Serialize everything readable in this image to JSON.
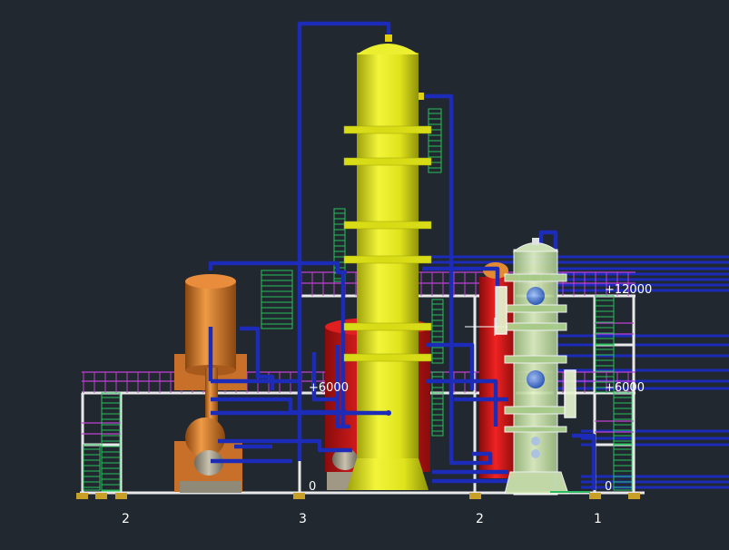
{
  "elevations": {
    "top": "+12000",
    "middle_left": "+6000",
    "middle_right": "+6000",
    "ground_left": "0",
    "ground_right": "0"
  },
  "grid_axes": [
    "2",
    "3",
    "2",
    "1"
  ],
  "colors": {
    "background": "#212830",
    "pipe": "#1c2bb8",
    "main_column": "#e6eb1e",
    "copper_vessel": "#d5782a",
    "red_vessel": "#d81818",
    "glass_column": "#c9e8a0",
    "platform": "#e8e8e8",
    "handrail": "#c040d0",
    "ladder": "#27c05a",
    "footing": "#c8a028"
  }
}
